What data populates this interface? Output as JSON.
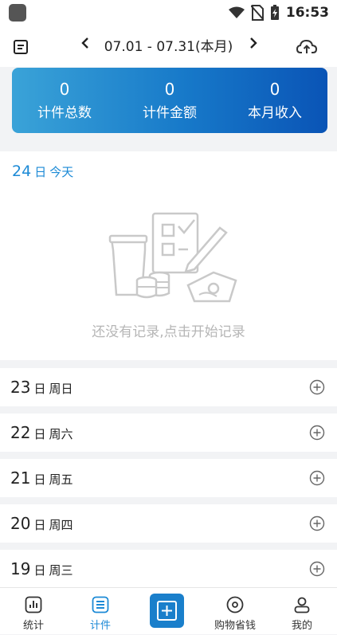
{
  "status_bar": {
    "time": "16:53"
  },
  "header": {
    "period": "07.01 - 07.31(本月)",
    "prev_icon": "chevron-left-icon",
    "next_icon": "chevron-right-icon"
  },
  "summary": {
    "items": [
      {
        "value": "0",
        "label": "计件总数"
      },
      {
        "value": "0",
        "label": "计件金额"
      },
      {
        "value": "0",
        "label": "本月收入"
      }
    ]
  },
  "today": {
    "day": "24",
    "unit": "日",
    "weekday": "今天",
    "empty_text": "还没有记录,点击开始记录"
  },
  "days": [
    {
      "day": "23",
      "unit": "日",
      "weekday": "周日"
    },
    {
      "day": "22",
      "unit": "日",
      "weekday": "周六"
    },
    {
      "day": "21",
      "unit": "日",
      "weekday": "周五"
    },
    {
      "day": "20",
      "unit": "日",
      "weekday": "周四"
    },
    {
      "day": "19",
      "unit": "日",
      "weekday": "周三"
    }
  ],
  "tabs": [
    {
      "label": "统计",
      "icon": "chart-icon"
    },
    {
      "label": "计件",
      "icon": "list-icon",
      "active": true
    },
    {
      "label": "",
      "icon": "add-icon"
    },
    {
      "label": "购物省钱",
      "icon": "coin-icon"
    },
    {
      "label": "我的",
      "icon": "user-icon"
    }
  ],
  "colors": {
    "accent": "#1c8ad6",
    "banner_start": "#3aa3d8",
    "banner_end": "#0a54b6"
  }
}
